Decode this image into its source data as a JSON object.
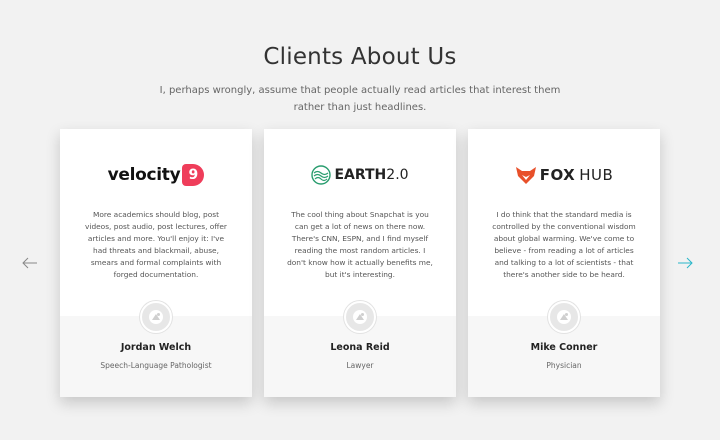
{
  "section": {
    "title": "Clients About Us",
    "subtitle": "I, perhaps wrongly, assume that people actually read articles that interest them rather than just headlines."
  },
  "colors": {
    "background": "#f2f2f2",
    "accent": "#2ab7c9",
    "velocity_badge": "#ef3d5a",
    "fox_orange": "#e8502a",
    "earth_green": "#2a9d6f"
  },
  "navigation": {
    "prev_icon": "arrow-left-icon",
    "next_icon": "arrow-right-icon"
  },
  "testimonials": [
    {
      "logo": {
        "text": "velocity",
        "badge": "9"
      },
      "quote": "More academics should blog, post videos, post audio, post lectures, offer articles and more. You'll enjoy it: I've had threats and blackmail, abuse, smears and formal complaints with forged documentation.",
      "name": "Jordan Welch",
      "role": "Speech-Language Pathologist",
      "avatar_icon": "user-placeholder-icon"
    },
    {
      "logo": {
        "text": "EARTH",
        "suffix": "2.0",
        "icon": "earth-waves-icon"
      },
      "quote": "The cool thing about Snapchat is you can get a lot of news on there now. There's CNN, ESPN, and I find myself reading the most random articles. I don't know how it actually benefits me, but it's interesting.",
      "name": "Leona Reid",
      "role": "Lawyer",
      "avatar_icon": "user-placeholder-icon"
    },
    {
      "logo": {
        "text": "FOX",
        "suffix": "HUB",
        "icon": "fox-head-icon"
      },
      "quote": "I do think that the standard media is controlled by the conventional wisdom about global warming. We've come to believe - from reading a lot of articles and talking to a lot of scientists - that there's another side to be heard.",
      "name": "Mike Conner",
      "role": "Physician",
      "avatar_icon": "user-placeholder-icon"
    }
  ]
}
